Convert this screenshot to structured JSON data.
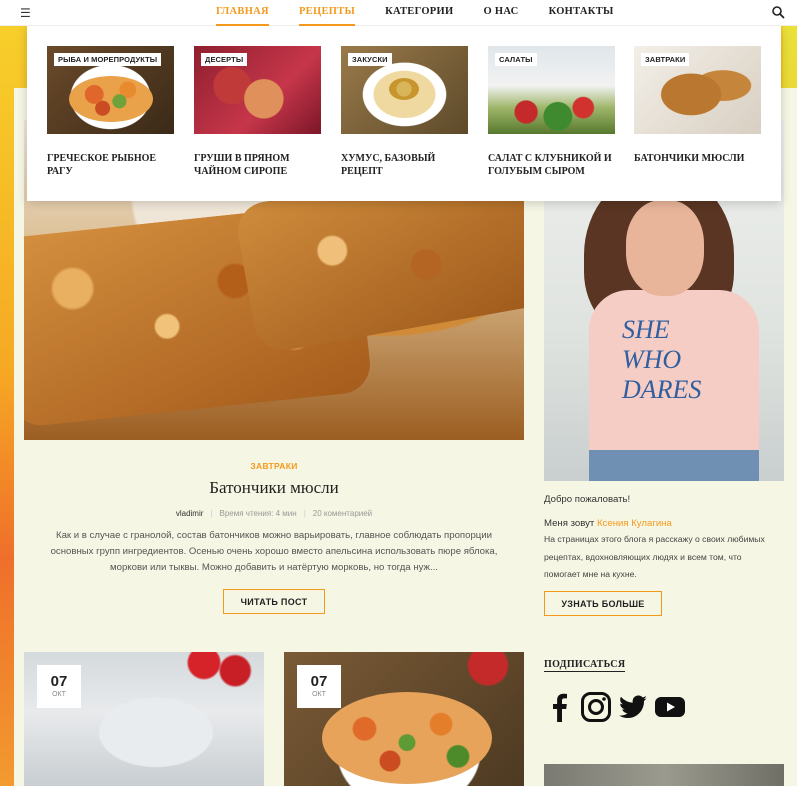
{
  "nav": {
    "items": [
      "ГЛАВНАЯ",
      "РЕЦЕПТЫ",
      "КАТЕГОРИИ",
      "О НАС",
      "КОНТАКТЫ"
    ],
    "active": [
      "ГЛАВНАЯ",
      "РЕЦЕПТЫ"
    ],
    "icons": {
      "menu": "hamburger-icon",
      "search": "search-icon"
    }
  },
  "mega_menu": {
    "items": [
      {
        "category": "РЫБА И МОРЕПРОДУКТЫ",
        "title": "ГРЕЧЕСКОЕ РЫБНОЕ РАГУ"
      },
      {
        "category": "ДЕСЕРТЫ",
        "title": "ГРУШИ В ПРЯНОМ ЧАЙНОМ СИРОПЕ"
      },
      {
        "category": "ЗАКУСКИ",
        "title": "ХУМУС, БАЗОВЫЙ РЕЦЕПТ"
      },
      {
        "category": "САЛАТЫ",
        "title": "САЛАТ С КЛУБНИКОЙ И ГОЛУБЫМ СЫРОМ"
      },
      {
        "category": "ЗАВТРАКИ",
        "title": "БАТОНЧИКИ МЮСЛИ"
      }
    ]
  },
  "featured": {
    "category": "ЗАВТРАКИ",
    "title": "Батончики мюсли",
    "author": "vladimir",
    "read_time": "Время чтения: 4 мин",
    "comments": "20 коментарией",
    "excerpt": "Как и в случае с гранолой, состав батончиков можно варьировать, главное соблюдать пропорции основных групп ингредиентов. Осенью очень хорошо вместо апельсина использовать пюре яблока, моркови или тыквы. Можно добавить и натёртую морковь, но тогда нуж...",
    "button": "ЧИТАТЬ ПОСТ"
  },
  "sidebar": {
    "welcome": "Добро пожаловать!",
    "intro_prefix": "Меня зовут",
    "name": "Ксения Кулагина",
    "intro_text": "На страницах этого блога я расскажу о своих любимых рецептах, вдохновляющих людях и всем том, что помогает мне на кухне.",
    "button": "УЗНАТЬ БОЛЬШЕ",
    "shirt_print": "SHE WHO DARES",
    "subscribe_title": "ПОДПИСАТЬСЯ",
    "social": [
      "facebook-icon",
      "instagram-icon",
      "twitter-icon",
      "youtube-icon"
    ]
  },
  "grid_posts": [
    {
      "day": "07",
      "month": "ОКТ"
    },
    {
      "day": "07",
      "month": "ОКТ"
    }
  ],
  "colors": {
    "accent": "#f39a1d",
    "panel": "#f6f6e4",
    "text": "#222222"
  }
}
